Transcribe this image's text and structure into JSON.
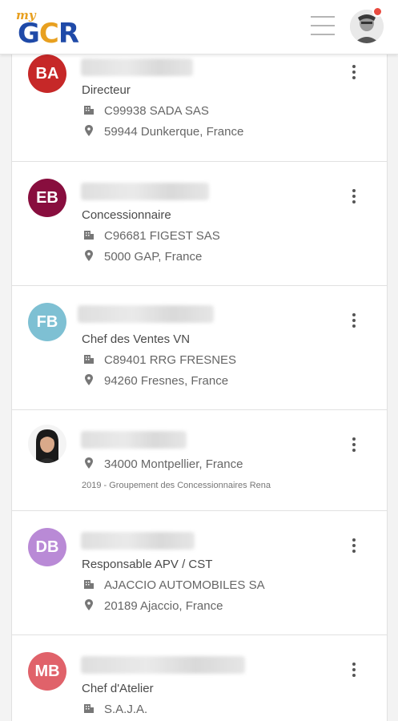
{
  "header": {
    "logo_prefix": "my",
    "logo_g": "G",
    "logo_c": "C",
    "logo_r": "R"
  },
  "contacts": [
    {
      "initials": "BA",
      "color": "#c62828",
      "role": "Directeur",
      "company": "C99938 SADA SAS",
      "location": "59944 Dunkerque, France"
    },
    {
      "initials": "EB",
      "color": "#880e3e",
      "role": "Concessionnaire",
      "company": "C96681 FIGEST SAS",
      "location": "5000 GAP, France"
    },
    {
      "initials": "FB",
      "color": "#7ec0d3",
      "role": "Chef des Ventes VN",
      "company": "C89401 RRG FRESNES",
      "location": "94260 Fresnes, France"
    },
    {
      "initials": "",
      "color": "#333333",
      "location": "34000 Montpellier, France",
      "note": "2019 - Groupement des Concessionnaires Rena"
    },
    {
      "initials": "DB",
      "color": "#b98ad6",
      "role": "Responsable APV / CST",
      "company": "AJACCIO AUTOMOBILES SA",
      "location": "20189 Ajaccio, France"
    },
    {
      "initials": "MB",
      "color": "#e0626a",
      "role": "Chef d'Atelier",
      "company": "S.A.J.A."
    }
  ],
  "icons": {
    "menu": "hamburger-menu-icon",
    "more": "more-vertical-icon",
    "company": "building-icon",
    "location": "map-pin-icon"
  }
}
